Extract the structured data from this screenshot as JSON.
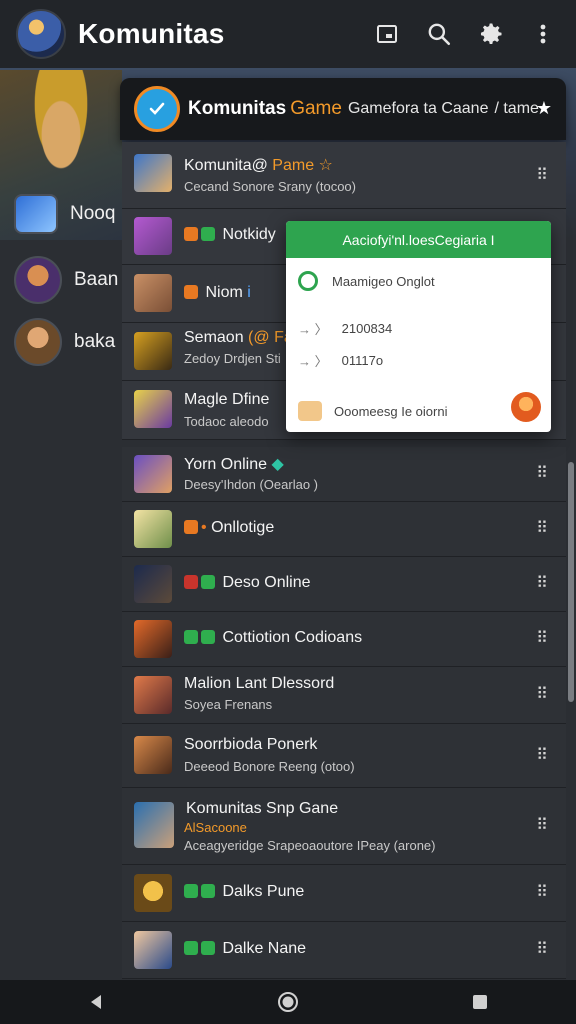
{
  "app": {
    "title": "Komunitas",
    "icons": {
      "app": "game-hero-avatar",
      "window": "window-icon",
      "search": "search-icon",
      "settings": "gear-icon",
      "more": "more-vertical-icon"
    }
  },
  "sidebar": {
    "items": [
      {
        "label": "Nooq",
        "icon": "game-badge-icon"
      },
      {
        "label": "Baan",
        "icon": "avatar"
      },
      {
        "label": "baka",
        "icon": "avatar"
      }
    ]
  },
  "panel_header": {
    "title": "Komunitas",
    "game": "Game",
    "subtitle": "Gamefora ta Caane",
    "extra": "/ tame",
    "star": "★"
  },
  "list": {
    "rows": [
      {
        "title": "Komunita@",
        "tag": "Pame ☆",
        "subtitle": "Cecand Sonore Srany (tocoo)"
      },
      {
        "title": "Notkidy",
        "subtitle": ""
      },
      {
        "title": "Niom",
        "tag": "i",
        "subtitle": ""
      },
      {
        "title": "Semaon",
        "tag": "(@ Fa",
        "subtitle": "Zedoy Drdjen Sti"
      },
      {
        "title": "Magle Dfine",
        "subtitle": "Todaoc aleodo"
      },
      {
        "title": "Yorn Online",
        "subtitle": "Deesy'Ihdon (Oearlao )"
      },
      {
        "title": "Onllotige",
        "subtitle": ""
      },
      {
        "title": "Deso Online",
        "subtitle": ""
      },
      {
        "title": "Cottiotion Codioans",
        "subtitle": ""
      },
      {
        "title": "Malion Lant Dlessord",
        "subtitle": "Soyea Frenans"
      },
      {
        "title": "Soorrbioda Ponerk",
        "subtitle": "Deeeod Bonore Reeng (otoo)"
      },
      {
        "title": "Komunitas Snp Gane",
        "tag": "AlSacoone",
        "subtitle": "Aceagyeridge Srapeoaoutore IPeay (arone)"
      },
      {
        "title": "Dalks Pune",
        "subtitle": ""
      },
      {
        "title": "Dalke Nane",
        "subtitle": ""
      }
    ]
  },
  "popup": {
    "title": "Aaciofyi'nl.loesCegiaria I",
    "line1": "Maamigeo Onglot",
    "line2": "2100834",
    "line3": "01117o",
    "footer": "Ooomeesg Ie oiorni"
  },
  "navbar": {
    "back": "back-icon",
    "home": "home-icon",
    "recents": "recents-icon"
  },
  "colors": {
    "accent_green": "#2ea44f",
    "accent_orange": "#f39a2a",
    "bar": "#222529",
    "panel": "#2e3136"
  }
}
